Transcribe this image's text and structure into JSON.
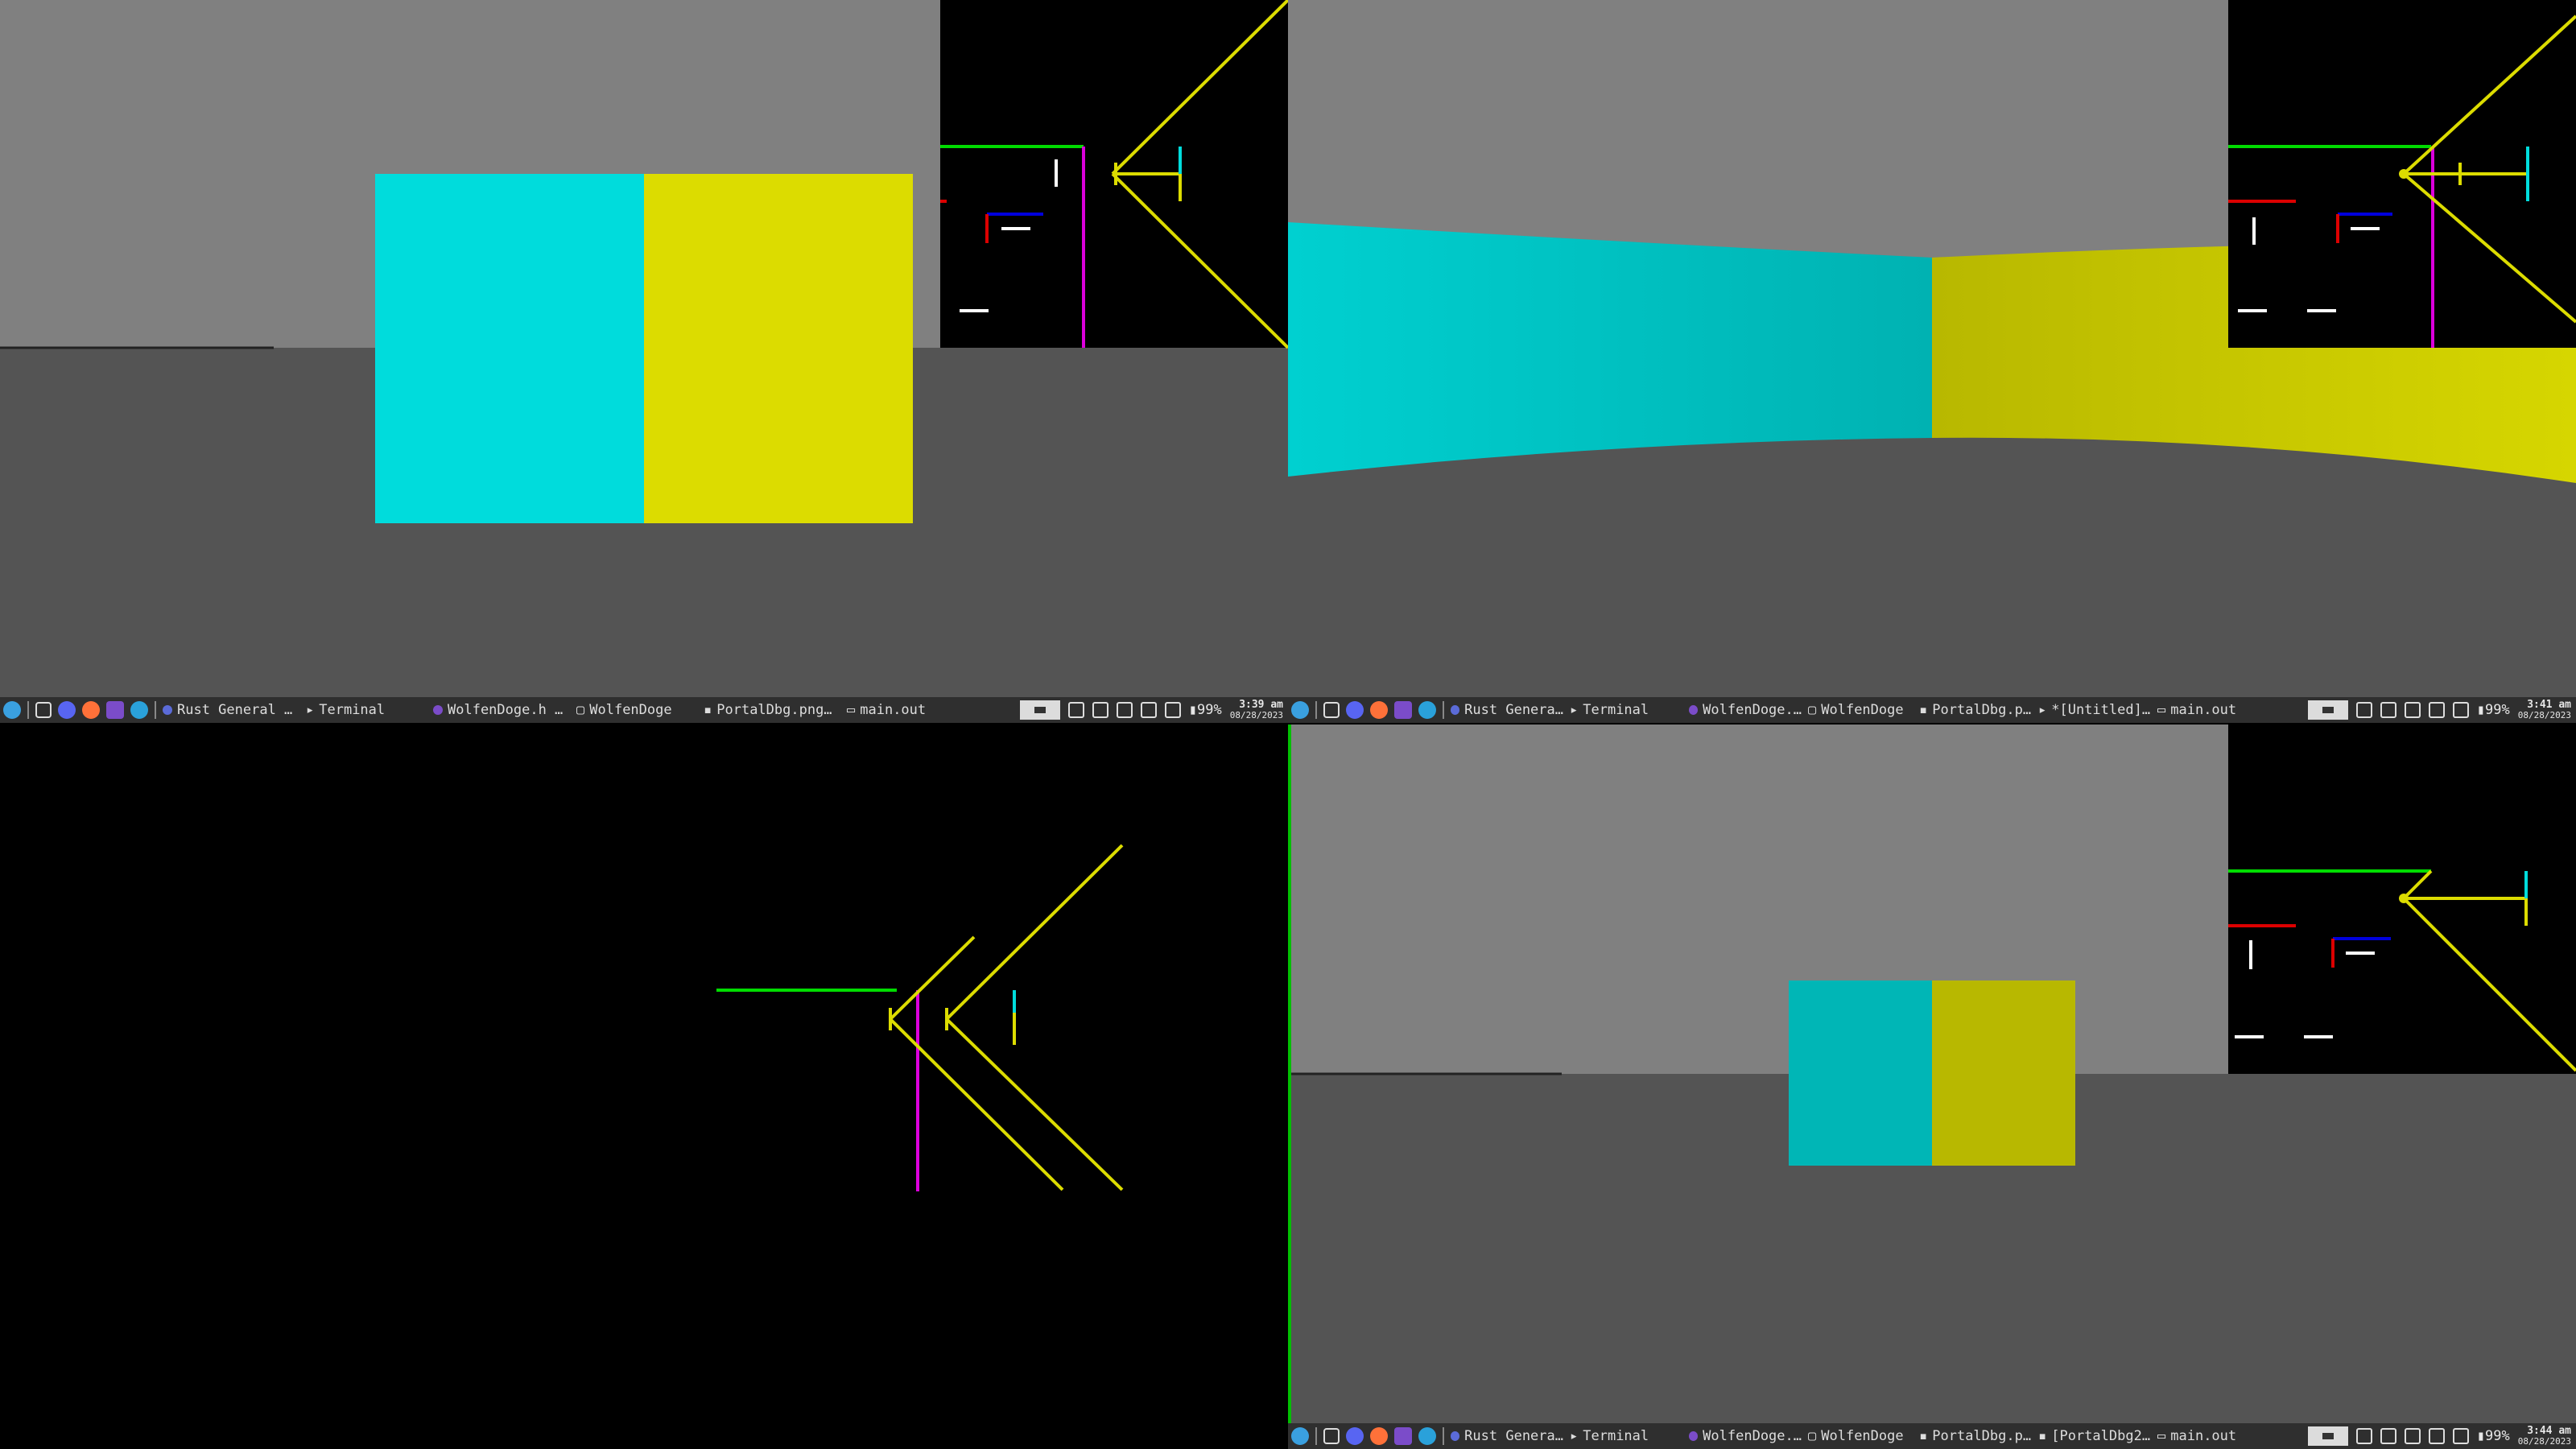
{
  "taskbars": [
    {
      "windows": [
        "Rust General …",
        "Terminal",
        "WolfenDoge.h …",
        "WolfenDoge",
        "PortalDbg.png…",
        "main.out"
      ],
      "battery": "99%",
      "time": "3:39 am",
      "date": "08/28/2023"
    },
    {
      "windows": [
        "Rust Genera…",
        "Terminal",
        "WolfenDoge.…",
        "WolfenDoge",
        "PortalDbg.p…",
        "*[Untitled]…",
        "main.out"
      ],
      "battery": "99%",
      "time": "3:41 am",
      "date": "08/28/2023"
    },
    {
      "windows": [
        "Rust Genera…",
        "Terminal",
        "WolfenDoge.…",
        "WolfenDoge",
        "PortalDbg.p…",
        "[PortalDbg2…",
        "main.out"
      ],
      "battery": "99%",
      "time": "3:44 am",
      "date": "08/28/2023"
    }
  ],
  "colors": {
    "ceiling": "#808080",
    "floor": "#545454",
    "wall_cyan": "#00dcdc",
    "wall_yellow": "#dcdc00",
    "minimap_bg": "#000000",
    "taskbar_bg": "#2f2f2f"
  },
  "icons": [
    "app-launcher-icon",
    "workspace-icon",
    "discord-icon",
    "firefox-icon",
    "purple-app-icon",
    "telegram-icon"
  ]
}
